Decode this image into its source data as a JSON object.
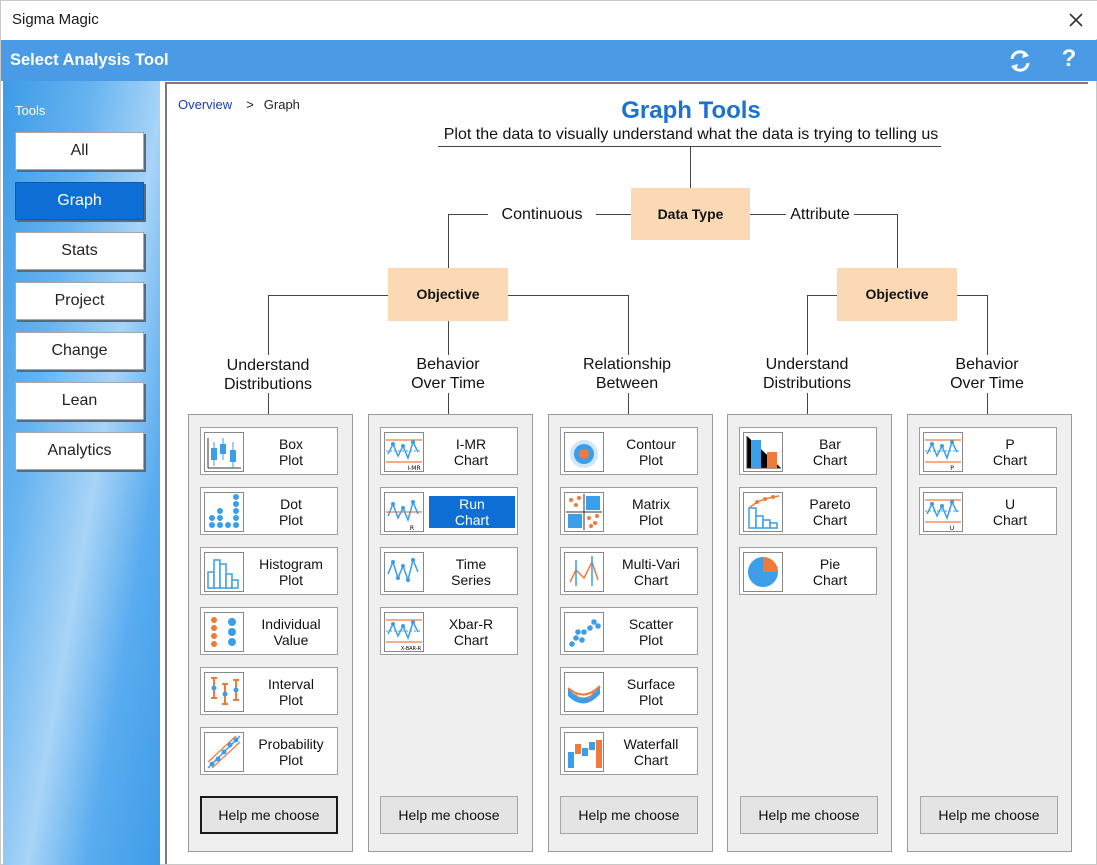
{
  "window": {
    "title": "Sigma Magic"
  },
  "header": {
    "title": "Select Analysis Tool"
  },
  "sidebar": {
    "label": "Tools",
    "items": [
      {
        "label": "All"
      },
      {
        "label": "Graph"
      },
      {
        "label": "Stats"
      },
      {
        "label": "Project"
      },
      {
        "label": "Change"
      },
      {
        "label": "Lean"
      },
      {
        "label": "Analytics"
      }
    ],
    "active": "Graph"
  },
  "breadcrumb": {
    "link": "Overview",
    "sep": ">",
    "current": "Graph"
  },
  "main": {
    "title": "Graph Tools",
    "subtitle": "Plot the data to visually understand what the data is trying to telling us",
    "data_type": "Data Type",
    "continuous": "Continuous",
    "attribute": "Attribute",
    "objective_left": "Objective",
    "objective_right": "Objective",
    "categories": [
      {
        "line1": "Understand",
        "line2": "Distributions"
      },
      {
        "line1": "Behavior",
        "line2": "Over Time"
      },
      {
        "line1": "Relationship",
        "line2": "Between"
      },
      {
        "line1": "Understand",
        "line2": "Distributions"
      },
      {
        "line1": "Behavior",
        "line2": "Over Time"
      }
    ],
    "panels": [
      {
        "help": "Help me choose",
        "tools": [
          {
            "line1": "Box",
            "line2": "Plot",
            "icon": "box-plot-icon"
          },
          {
            "line1": "Dot",
            "line2": "Plot",
            "icon": "dot-plot-icon"
          },
          {
            "line1": "Histogram",
            "line2": "Plot",
            "icon": "histogram-icon"
          },
          {
            "line1": "Individual",
            "line2": "Value",
            "icon": "individual-value-icon"
          },
          {
            "line1": "Interval",
            "line2": "Plot",
            "icon": "interval-plot-icon"
          },
          {
            "line1": "Probability",
            "line2": "Plot",
            "icon": "probability-plot-icon"
          }
        ]
      },
      {
        "help": "Help me choose",
        "tools": [
          {
            "line1": "I-MR",
            "line2": "Chart",
            "icon": "imr-chart-icon"
          },
          {
            "line1": "Run",
            "line2": "Chart",
            "icon": "run-chart-icon"
          },
          {
            "line1": "Time",
            "line2": "Series",
            "icon": "time-series-icon"
          },
          {
            "line1": "Xbar-R",
            "line2": "Chart",
            "icon": "xbar-r-chart-icon"
          }
        ]
      },
      {
        "help": "Help me choose",
        "tools": [
          {
            "line1": "Contour",
            "line2": "Plot",
            "icon": "contour-plot-icon"
          },
          {
            "line1": "Matrix",
            "line2": "Plot",
            "icon": "matrix-plot-icon"
          },
          {
            "line1": "Multi-Vari",
            "line2": "Chart",
            "icon": "multi-vari-icon"
          },
          {
            "line1": "Scatter",
            "line2": "Plot",
            "icon": "scatter-plot-icon"
          },
          {
            "line1": "Surface",
            "line2": "Plot",
            "icon": "surface-plot-icon"
          },
          {
            "line1": "Waterfall",
            "line2": "Chart",
            "icon": "waterfall-chart-icon"
          }
        ]
      },
      {
        "help": "Help me choose",
        "tools": [
          {
            "line1": "Bar",
            "line2": "Chart",
            "icon": "bar-chart-icon"
          },
          {
            "line1": "Pareto",
            "line2": "Chart",
            "icon": "pareto-chart-icon"
          },
          {
            "line1": "Pie",
            "line2": "Chart",
            "icon": "pie-chart-icon"
          }
        ]
      },
      {
        "help": "Help me choose",
        "tools": [
          {
            "line1": "P",
            "line2": "Chart",
            "icon": "p-chart-icon"
          },
          {
            "line1": "U",
            "line2": "Chart",
            "icon": "u-chart-icon"
          }
        ]
      }
    ],
    "icon_captions": {
      "imr": "I-MR",
      "run": "R",
      "xbar": "X-BAR-R",
      "p": "P",
      "u": "U"
    }
  },
  "colors": {
    "accent": "#4a9ae6",
    "selected": "#0d6fd6",
    "objective_box": "#fbd9b5",
    "title": "#1a73cf",
    "icon_orange": "#f07a3a",
    "icon_blue": "#3b9ee8"
  }
}
